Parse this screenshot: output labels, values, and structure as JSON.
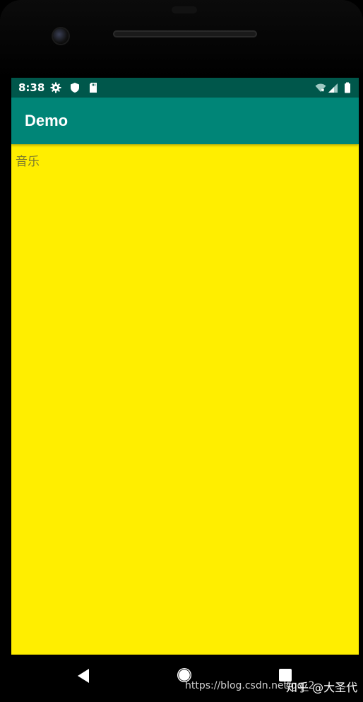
{
  "status_bar": {
    "time": "8:38",
    "left_icons": [
      "gear-icon",
      "shield-icon",
      "sd-card-icon"
    ],
    "right_icons": [
      "wifi-off-icon",
      "signal-icon",
      "battery-icon"
    ],
    "background": "#00574b"
  },
  "app_bar": {
    "title": "Demo",
    "background": "#008577"
  },
  "content": {
    "text": "音乐",
    "background": "#ffee00"
  },
  "nav_bar": {
    "buttons": [
      "back-icon",
      "home-icon",
      "recents-icon"
    ]
  },
  "watermark": {
    "url": "https://blog.csdn.net/qq_2",
    "tail": "知乎 @大圣代"
  }
}
